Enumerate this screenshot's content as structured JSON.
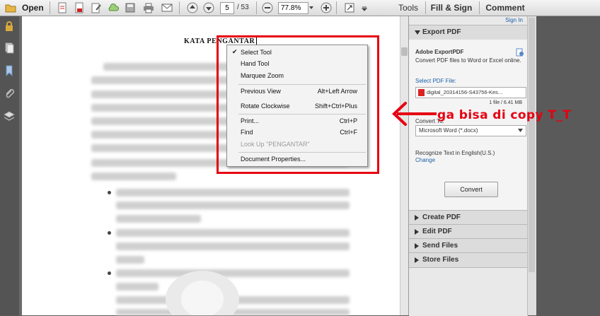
{
  "toolbar": {
    "open_label": "Open",
    "page_current": "5",
    "page_total": "/ 53",
    "zoom_value": "77.8%",
    "tabs": {
      "tools": "Tools",
      "fill_sign": "Fill & Sign",
      "comment": "Comment"
    }
  },
  "document": {
    "title": "KATA PENGANTAR"
  },
  "context_menu": {
    "items": [
      {
        "label": "Select Tool",
        "shortcut": "",
        "checked": true,
        "disabled": false
      },
      {
        "label": "Hand Tool",
        "shortcut": "",
        "checked": false,
        "disabled": false
      },
      {
        "label": "Marquee Zoom",
        "shortcut": "",
        "checked": false,
        "disabled": false
      },
      {
        "label": "Previous View",
        "shortcut": "Alt+Left Arrow",
        "checked": false,
        "disabled": false
      },
      {
        "label": "Rotate Clockwise",
        "shortcut": "Shift+Ctrl+Plus",
        "checked": false,
        "disabled": false
      },
      {
        "label": "Print...",
        "shortcut": "Ctrl+P",
        "checked": false,
        "disabled": false
      },
      {
        "label": "Find",
        "shortcut": "Ctrl+F",
        "checked": false,
        "disabled": false
      },
      {
        "label": "Look Up \"PENGANTAR\"",
        "shortcut": "",
        "checked": false,
        "disabled": true
      },
      {
        "label": "Document Properties...",
        "shortcut": "",
        "checked": false,
        "disabled": false
      }
    ]
  },
  "annotation": {
    "text": "ga bisa di copy T_T",
    "color": "#e60012"
  },
  "side_panel": {
    "sign_in": "Sign In",
    "export_pdf": {
      "title": "Export PDF",
      "service": "Adobe ExportPDF",
      "description": "Convert PDF files to Word or Excel online.",
      "select_file_label": "Select PDF File:",
      "file_name": "digital_20314156-S43756-Kes...",
      "file_info": "1 file / 6.41 MB",
      "convert_to_label": "Convert To:",
      "convert_to_value": "Microsoft Word (*.docx)",
      "recognize_text": "Recognize Text in English(U.S.)",
      "change_link": "Change",
      "convert_button": "Convert"
    },
    "sections": [
      "Create PDF",
      "Edit PDF",
      "Send Files",
      "Store Files"
    ]
  },
  "colors": {
    "accent_link": "#1a5fa8",
    "highlight_red": "#e60012"
  }
}
